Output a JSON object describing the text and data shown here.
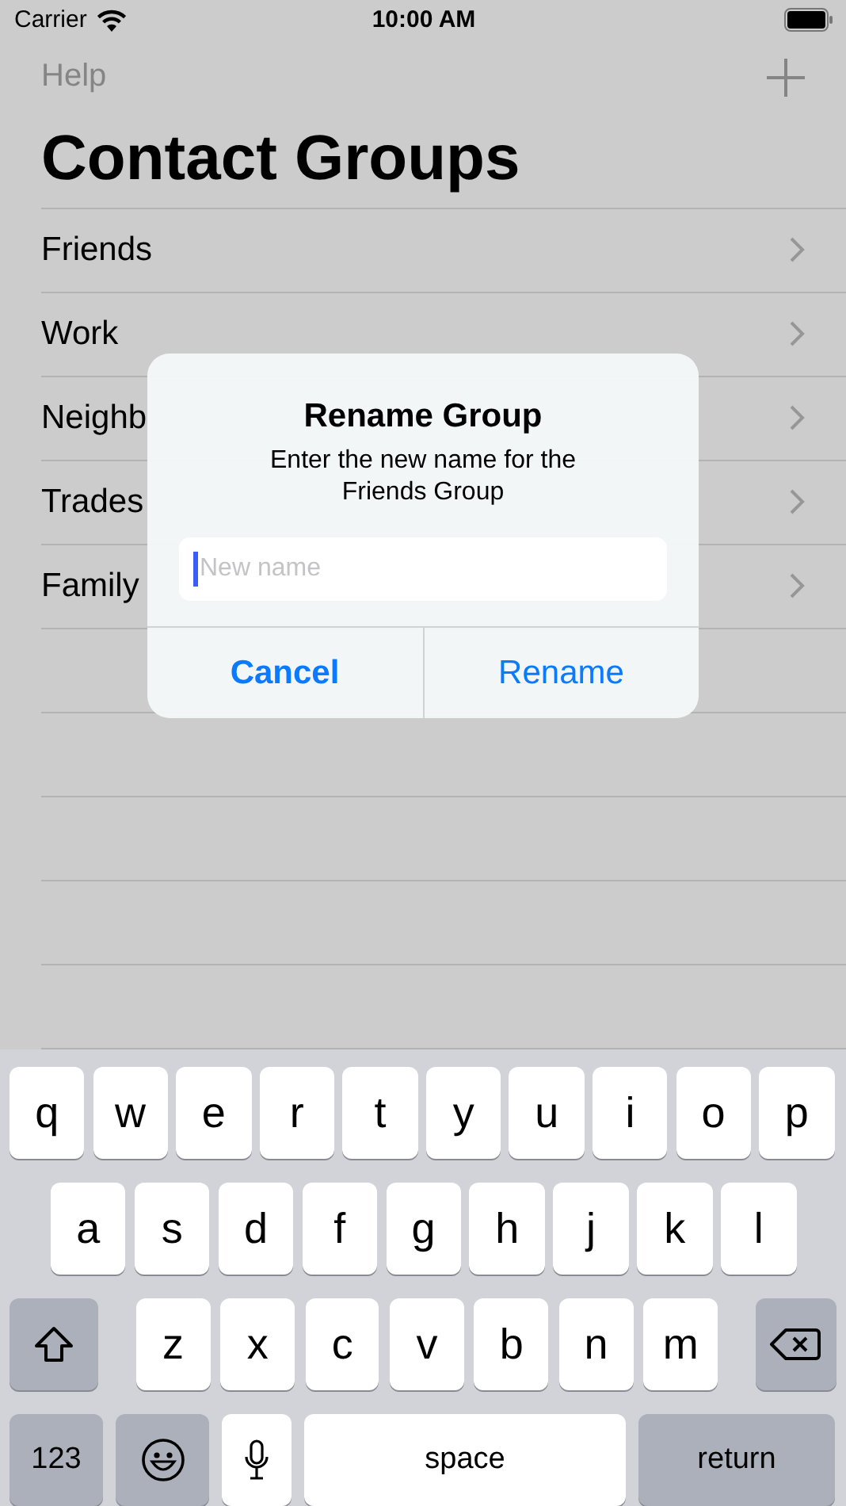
{
  "status_bar": {
    "carrier": "Carrier",
    "time": "10:00 AM"
  },
  "nav": {
    "left_button": "Help"
  },
  "title": "Contact Groups",
  "groups": [
    {
      "name": "Friends"
    },
    {
      "name": "Work"
    },
    {
      "name": "Neighb"
    },
    {
      "name": "Trades"
    },
    {
      "name": "Family"
    }
  ],
  "dialog": {
    "title": "Rename Group",
    "message": "Enter the new name for the Friends Group",
    "field": {
      "placeholder": "New name"
    },
    "buttons": [
      {
        "label": "Cancel",
        "kind": "cancel"
      },
      {
        "label": "Rename",
        "kind": "default"
      }
    ]
  },
  "keyboard": [
    [
      {
        "kind": "letter",
        "label": "q"
      },
      {
        "kind": "letter",
        "label": "w"
      },
      {
        "kind": "letter",
        "label": "e"
      },
      {
        "kind": "letter",
        "label": "r"
      },
      {
        "kind": "letter",
        "label": "t"
      },
      {
        "kind": "letter",
        "label": "y"
      },
      {
        "kind": "letter",
        "label": "u"
      },
      {
        "kind": "letter",
        "label": "i"
      },
      {
        "kind": "letter",
        "label": "o"
      },
      {
        "kind": "letter",
        "label": "p"
      }
    ],
    [
      {
        "kind": "letter",
        "label": "a"
      },
      {
        "kind": "letter",
        "label": "s"
      },
      {
        "kind": "letter",
        "label": "d"
      },
      {
        "kind": "letter",
        "label": "f"
      },
      {
        "kind": "letter",
        "label": "g"
      },
      {
        "kind": "letter",
        "label": "h"
      },
      {
        "kind": "letter",
        "label": "j"
      },
      {
        "kind": "letter",
        "label": "k"
      },
      {
        "kind": "letter",
        "label": "l"
      }
    ],
    [
      {
        "kind": "shift"
      },
      {
        "kind": "letter",
        "label": "z"
      },
      {
        "kind": "letter",
        "label": "x"
      },
      {
        "kind": "letter",
        "label": "c"
      },
      {
        "kind": "letter",
        "label": "v"
      },
      {
        "kind": "letter",
        "label": "b"
      },
      {
        "kind": "letter",
        "label": "n"
      },
      {
        "kind": "letter",
        "label": "m"
      },
      {
        "kind": "delete"
      }
    ],
    [
      {
        "kind": "numbers",
        "label": "123"
      },
      {
        "kind": "emoji"
      },
      {
        "kind": "mic"
      },
      {
        "kind": "space",
        "label": "space"
      },
      {
        "kind": "return",
        "label": "return"
      }
    ]
  ]
}
